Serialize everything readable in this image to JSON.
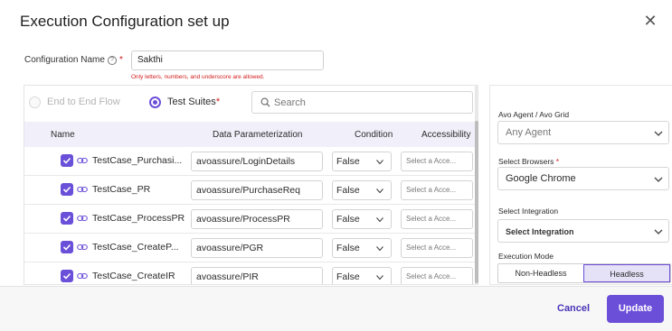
{
  "dialog": {
    "title": "Execution Configuration set up"
  },
  "config": {
    "label": "Configuration Name",
    "required_mark": "*",
    "value": "Sakthi",
    "hint": "Only letters, numbers, and underscore are allowed."
  },
  "selection": {
    "options": [
      "End to End Flow",
      "Test Suites"
    ],
    "selected": "Test Suites",
    "required_mark": "*",
    "search_placeholder": "Search"
  },
  "table": {
    "columns": [
      "Name",
      "Data Parameterization",
      "Condition",
      "Accessibility"
    ],
    "rows": [
      {
        "checked": true,
        "name": "TestCase_Purchasi...",
        "data": "avoassure/LoginDetails",
        "condition": "False",
        "accessibility": "Select a Acce..."
      },
      {
        "checked": true,
        "name": "TestCase_PR",
        "data": "avoassure/PurchaseReq",
        "condition": "False",
        "accessibility": "Select a Acce..."
      },
      {
        "checked": true,
        "name": "TestCase_ProcessPR",
        "data": "avoassure/ProcessPR",
        "condition": "False",
        "accessibility": "Select a Acce..."
      },
      {
        "checked": true,
        "name": "TestCase_CreateP...",
        "data": "avoassure/PGR",
        "condition": "False",
        "accessibility": "Select a Acce..."
      },
      {
        "checked": true,
        "name": "TestCase_CreateIR",
        "data": "avoassure/PIR",
        "condition": "False",
        "accessibility": "Select a Acce..."
      }
    ]
  },
  "settings": {
    "agent_label": "Avo Agent / Avo Grid",
    "agent_value": "Any Agent",
    "browsers_label": "Select Browsers",
    "browsers_required_mark": "*",
    "browsers_value": "Google Chrome",
    "integration_label": "Select Integration",
    "integration_value": "Select Integration",
    "mode_label": "Execution Mode",
    "modes": [
      "Non-Headless",
      "Headless"
    ],
    "selected_mode": "Headless"
  },
  "footer": {
    "cancel_label": "Cancel",
    "update_label": "Update"
  },
  "colors": {
    "accent": "#6b4fd9",
    "error": "#d11d1d",
    "header_bg": "#f1f0fa",
    "footer_bg": "#f7f7f7"
  }
}
